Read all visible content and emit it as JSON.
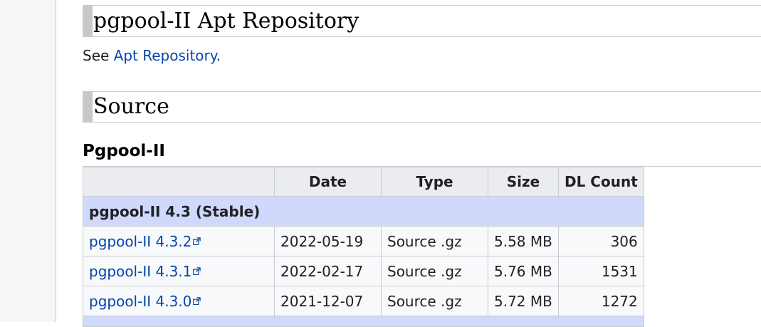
{
  "sections": {
    "apt": {
      "heading": "pgpool-II Apt Repository",
      "text_prefix": "See ",
      "link_label": "Apt Repository",
      "text_suffix": "."
    },
    "source": {
      "heading": "Source",
      "subheading": "Pgpool-II"
    }
  },
  "table": {
    "headers": [
      "",
      "Date",
      "Type",
      "Size",
      "DL Count"
    ],
    "group_label": "pgpool-II 4.3 (Stable)",
    "rows": [
      {
        "name": "pgpool-II 4.3.2",
        "date": "2022-05-19",
        "type": "Source .gz",
        "size": "5.58 MB",
        "count": "306"
      },
      {
        "name": "pgpool-II 4.3.1",
        "date": "2022-02-17",
        "type": "Source .gz",
        "size": "5.76 MB",
        "count": "1531"
      },
      {
        "name": "pgpool-II 4.3.0",
        "date": "2021-12-07",
        "type": "Source .gz",
        "size": "5.72 MB",
        "count": "1272"
      }
    ]
  },
  "icons": {
    "external_link": "external-link-icon"
  },
  "colors": {
    "link": "#0645ad",
    "group_row": "#d0d8fc",
    "header_row": "#eaecf0"
  }
}
